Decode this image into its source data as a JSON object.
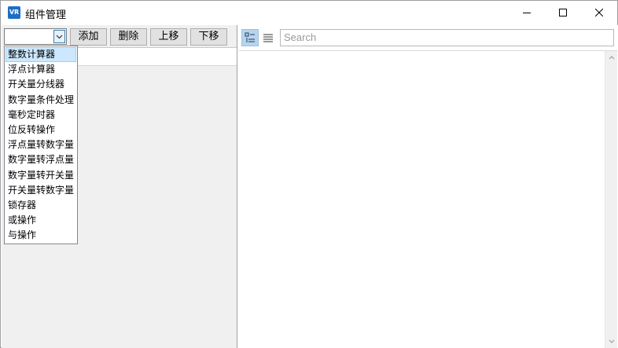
{
  "window": {
    "title": "组件管理",
    "icon": "vr-app-icon"
  },
  "toolbar": {
    "combo_value": "",
    "add_label": "添加",
    "delete_label": "删除",
    "up_label": "上移",
    "down_label": "下移"
  },
  "dropdown": {
    "selected_index": 0,
    "items": [
      "整数计算器",
      "浮点计算器",
      "开关量分线器",
      "数字量条件处理",
      "毫秒定时器",
      "位反转操作",
      "浮点量转数字量",
      "数字量转浮点量",
      "数字量转开关量",
      "开关量转数字量",
      "锁存器",
      "或操作",
      "与操作"
    ]
  },
  "properties": {
    "search_placeholder": "Search"
  },
  "colors": {
    "selected_bg": "#cce8ff",
    "accent": "#1e6fc4",
    "pane_bg": "#f0f0f0"
  }
}
